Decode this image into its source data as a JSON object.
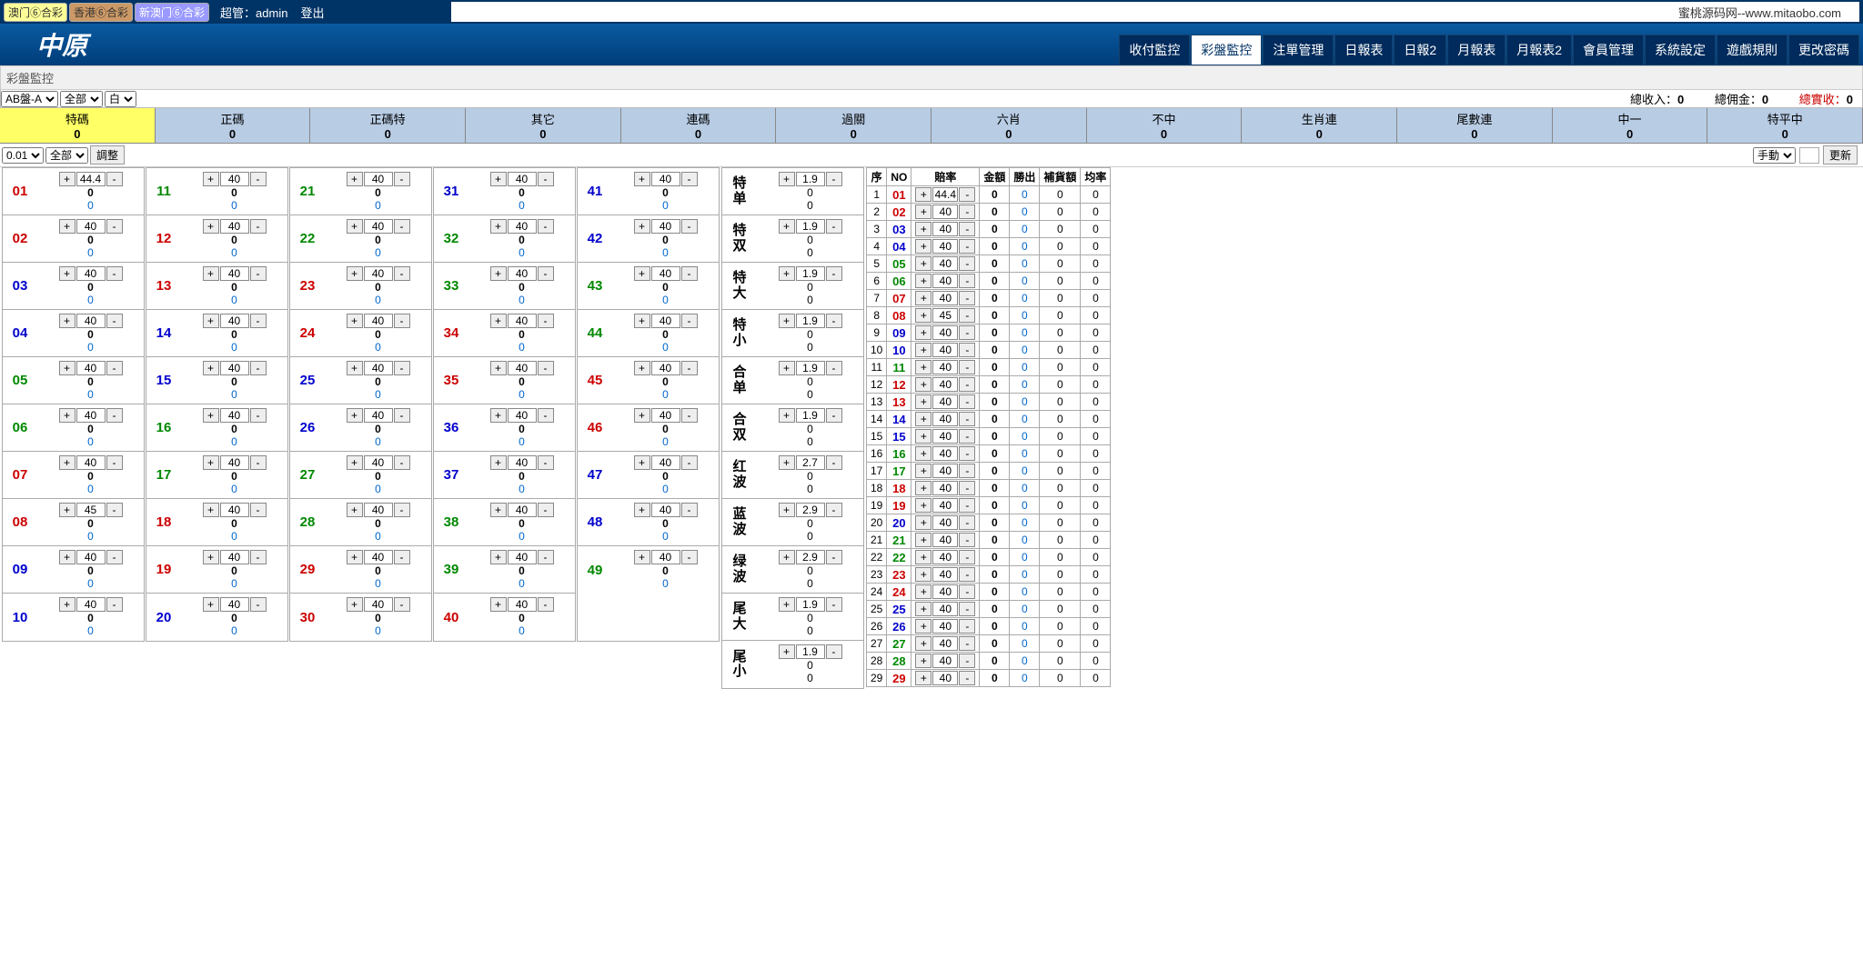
{
  "topbar": {
    "tags": [
      "澳门⑥合彩",
      "香港⑥合彩",
      "新澳门⑥合彩"
    ],
    "admin_label": "超管：admin",
    "logout": "登出",
    "site_url": "蜜桃源码网--www.mitaobo.com"
  },
  "brand": "中原",
  "nav": [
    "收付監控",
    "彩盤監控",
    "注單管理",
    "日報表",
    "日報2",
    "月報表",
    "月報表2",
    "會員管理",
    "系統設定",
    "遊戲規則",
    "更改密碼"
  ],
  "nav_active": 1,
  "subtitle": "彩盤監控",
  "filters": {
    "sel1": "AB盤-A",
    "sel2": "全部",
    "sel3": "白",
    "totals": {
      "income_lbl": "總收入：",
      "income": "0",
      "comm_lbl": "總佣金：",
      "comm": "0",
      "real_lbl": "總實收：",
      "real": "0"
    }
  },
  "cats": [
    {
      "label": "特碼",
      "v": "0",
      "active": true
    },
    {
      "label": "正碼",
      "v": "0"
    },
    {
      "label": "正碼特",
      "v": "0"
    },
    {
      "label": "其它",
      "v": "0"
    },
    {
      "label": "連碼",
      "v": "0"
    },
    {
      "label": "過關",
      "v": "0"
    },
    {
      "label": "六肖",
      "v": "0"
    },
    {
      "label": "不中",
      "v": "0"
    },
    {
      "label": "生肖連",
      "v": "0"
    },
    {
      "label": "尾數連",
      "v": "0"
    },
    {
      "label": "中一",
      "v": "0"
    },
    {
      "label": "特平中",
      "v": "0"
    }
  ],
  "adj": {
    "sel1": "0.01",
    "sel2": "全部",
    "btn": "調整",
    "mode": "手動",
    "update": "更新"
  },
  "numcols": [
    [
      {
        "n": "01",
        "c": "red",
        "o": "44.4"
      },
      {
        "n": "02",
        "c": "red",
        "o": "40"
      },
      {
        "n": "03",
        "c": "blue",
        "o": "40"
      },
      {
        "n": "04",
        "c": "blue",
        "o": "40"
      },
      {
        "n": "05",
        "c": "green",
        "o": "40"
      },
      {
        "n": "06",
        "c": "green",
        "o": "40"
      },
      {
        "n": "07",
        "c": "red",
        "o": "40"
      },
      {
        "n": "08",
        "c": "red",
        "o": "45"
      },
      {
        "n": "09",
        "c": "blue",
        "o": "40"
      },
      {
        "n": "10",
        "c": "blue",
        "o": "40"
      }
    ],
    [
      {
        "n": "11",
        "c": "green",
        "o": "40"
      },
      {
        "n": "12",
        "c": "red",
        "o": "40"
      },
      {
        "n": "13",
        "c": "red",
        "o": "40"
      },
      {
        "n": "14",
        "c": "blue",
        "o": "40"
      },
      {
        "n": "15",
        "c": "blue",
        "o": "40"
      },
      {
        "n": "16",
        "c": "green",
        "o": "40"
      },
      {
        "n": "17",
        "c": "green",
        "o": "40"
      },
      {
        "n": "18",
        "c": "red",
        "o": "40"
      },
      {
        "n": "19",
        "c": "red",
        "o": "40"
      },
      {
        "n": "20",
        "c": "blue",
        "o": "40"
      }
    ],
    [
      {
        "n": "21",
        "c": "green",
        "o": "40"
      },
      {
        "n": "22",
        "c": "green",
        "o": "40"
      },
      {
        "n": "23",
        "c": "red",
        "o": "40"
      },
      {
        "n": "24",
        "c": "red",
        "o": "40"
      },
      {
        "n": "25",
        "c": "blue",
        "o": "40"
      },
      {
        "n": "26",
        "c": "blue",
        "o": "40"
      },
      {
        "n": "27",
        "c": "green",
        "o": "40"
      },
      {
        "n": "28",
        "c": "green",
        "o": "40"
      },
      {
        "n": "29",
        "c": "red",
        "o": "40"
      },
      {
        "n": "30",
        "c": "red",
        "o": "40"
      }
    ],
    [
      {
        "n": "31",
        "c": "blue",
        "o": "40"
      },
      {
        "n": "32",
        "c": "green",
        "o": "40"
      },
      {
        "n": "33",
        "c": "green",
        "o": "40"
      },
      {
        "n": "34",
        "c": "red",
        "o": "40"
      },
      {
        "n": "35",
        "c": "red",
        "o": "40"
      },
      {
        "n": "36",
        "c": "blue",
        "o": "40"
      },
      {
        "n": "37",
        "c": "blue",
        "o": "40"
      },
      {
        "n": "38",
        "c": "green",
        "o": "40"
      },
      {
        "n": "39",
        "c": "green",
        "o": "40"
      },
      {
        "n": "40",
        "c": "red",
        "o": "40"
      }
    ],
    [
      {
        "n": "41",
        "c": "blue",
        "o": "40"
      },
      {
        "n": "42",
        "c": "blue",
        "o": "40"
      },
      {
        "n": "43",
        "c": "green",
        "o": "40"
      },
      {
        "n": "44",
        "c": "green",
        "o": "40"
      },
      {
        "n": "45",
        "c": "red",
        "o": "40"
      },
      {
        "n": "46",
        "c": "red",
        "o": "40"
      },
      {
        "n": "47",
        "c": "blue",
        "o": "40"
      },
      {
        "n": "48",
        "c": "blue",
        "o": "40"
      },
      {
        "n": "49",
        "c": "green",
        "o": "40"
      }
    ]
  ],
  "sidecats": [
    {
      "label": "特单",
      "o": "1.9"
    },
    {
      "label": "特双",
      "o": "1.9"
    },
    {
      "label": "特大",
      "o": "1.9"
    },
    {
      "label": "特小",
      "o": "1.9"
    },
    {
      "label": "合单",
      "o": "1.9"
    },
    {
      "label": "合双",
      "o": "1.9"
    },
    {
      "label": "红波",
      "o": "2.7"
    },
    {
      "label": "蓝波",
      "o": "2.9"
    },
    {
      "label": "绿波",
      "o": "2.9"
    },
    {
      "label": "尾大",
      "o": "1.9"
    },
    {
      "label": "尾小",
      "o": "1.9"
    }
  ],
  "rtable": {
    "headers": [
      "序",
      "NO",
      "賠率",
      "金額",
      "勝出",
      "補貨額",
      "均率"
    ],
    "rows": [
      {
        "i": 1,
        "no": "01",
        "c": "red",
        "o": "44.4"
      },
      {
        "i": 2,
        "no": "02",
        "c": "red",
        "o": "40"
      },
      {
        "i": 3,
        "no": "03",
        "c": "blue",
        "o": "40"
      },
      {
        "i": 4,
        "no": "04",
        "c": "blue",
        "o": "40"
      },
      {
        "i": 5,
        "no": "05",
        "c": "green",
        "o": "40"
      },
      {
        "i": 6,
        "no": "06",
        "c": "green",
        "o": "40"
      },
      {
        "i": 7,
        "no": "07",
        "c": "red",
        "o": "40"
      },
      {
        "i": 8,
        "no": "08",
        "c": "red",
        "o": "45"
      },
      {
        "i": 9,
        "no": "09",
        "c": "blue",
        "o": "40"
      },
      {
        "i": 10,
        "no": "10",
        "c": "blue",
        "o": "40"
      },
      {
        "i": 11,
        "no": "11",
        "c": "green",
        "o": "40"
      },
      {
        "i": 12,
        "no": "12",
        "c": "red",
        "o": "40"
      },
      {
        "i": 13,
        "no": "13",
        "c": "red",
        "o": "40"
      },
      {
        "i": 14,
        "no": "14",
        "c": "blue",
        "o": "40"
      },
      {
        "i": 15,
        "no": "15",
        "c": "blue",
        "o": "40"
      },
      {
        "i": 16,
        "no": "16",
        "c": "green",
        "o": "40"
      },
      {
        "i": 17,
        "no": "17",
        "c": "green",
        "o": "40"
      },
      {
        "i": 18,
        "no": "18",
        "c": "red",
        "o": "40"
      },
      {
        "i": 19,
        "no": "19",
        "c": "red",
        "o": "40"
      },
      {
        "i": 20,
        "no": "20",
        "c": "blue",
        "o": "40"
      },
      {
        "i": 21,
        "no": "21",
        "c": "green",
        "o": "40"
      },
      {
        "i": 22,
        "no": "22",
        "c": "green",
        "o": "40"
      },
      {
        "i": 23,
        "no": "23",
        "c": "red",
        "o": "40"
      },
      {
        "i": 24,
        "no": "24",
        "c": "red",
        "o": "40"
      },
      {
        "i": 25,
        "no": "25",
        "c": "blue",
        "o": "40"
      },
      {
        "i": 26,
        "no": "26",
        "c": "blue",
        "o": "40"
      },
      {
        "i": 27,
        "no": "27",
        "c": "green",
        "o": "40"
      },
      {
        "i": 28,
        "no": "28",
        "c": "green",
        "o": "40"
      },
      {
        "i": 29,
        "no": "29",
        "c": "red",
        "o": "40"
      }
    ]
  }
}
